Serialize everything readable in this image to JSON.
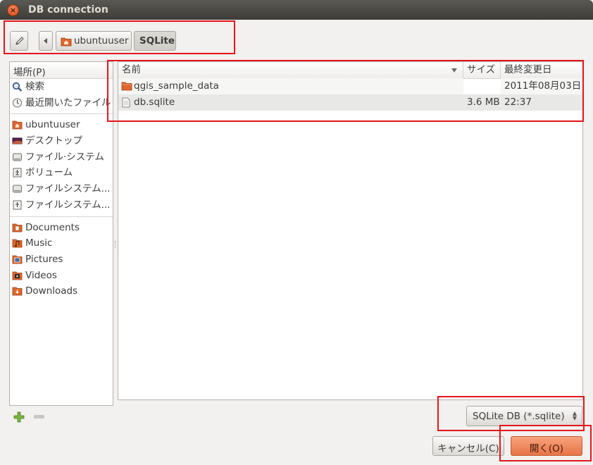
{
  "window": {
    "title": "DB connection",
    "close_glyph": "×"
  },
  "path_bar": {
    "edit_icon": "pencil-icon",
    "segments": [
      {
        "label": "ubuntuuser",
        "icon": "home-folder-icon"
      },
      {
        "label": "SQLite"
      }
    ]
  },
  "places": {
    "header": "場所(P)",
    "items": [
      {
        "label": "検索",
        "icon": "search-icon"
      },
      {
        "label": "最近開いたファイル",
        "icon": "recent-icon"
      },
      {
        "label": "ubuntuuser",
        "icon": "home-folder-icon"
      },
      {
        "label": "デスクトップ",
        "icon": "desktop-icon"
      },
      {
        "label": "ファイル·システム",
        "icon": "drive-icon"
      },
      {
        "label": "ボリューム",
        "icon": "usb-drive-icon"
      },
      {
        "label": "ファイルシステム...",
        "icon": "drive-icon"
      },
      {
        "label": "ファイルシステム...",
        "icon": "drive-icon"
      },
      {
        "label": "Documents",
        "icon": "documents-folder-icon"
      },
      {
        "label": "Music",
        "icon": "music-folder-icon"
      },
      {
        "label": "Pictures",
        "icon": "pictures-folder-icon"
      },
      {
        "label": "Videos",
        "icon": "videos-folder-icon"
      },
      {
        "label": "Downloads",
        "icon": "downloads-folder-icon"
      }
    ]
  },
  "files": {
    "columns": {
      "name": "名前",
      "size": "サイズ",
      "modified": "最終変更日"
    },
    "rows": [
      {
        "name": "qgis_sample_data",
        "size": "",
        "modified": "2011年08月03日",
        "icon": "folder-icon"
      },
      {
        "name": "db.sqlite",
        "size": "3.6 MB",
        "modified": "22:37",
        "icon": "file-icon"
      }
    ]
  },
  "filter": {
    "selected": "SQLite DB (*.sqlite)"
  },
  "buttons": {
    "cancel": "キャンセル(C)",
    "open": "開く(O)"
  },
  "colors": {
    "accent": "#e87446",
    "highlight_box": "#e4161a",
    "folder": "#e0672c"
  }
}
